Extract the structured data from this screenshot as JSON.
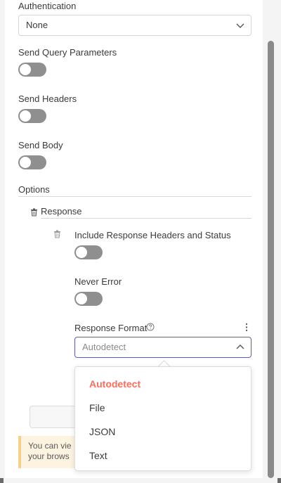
{
  "authentication": {
    "label": "Authentication",
    "value": "None"
  },
  "send_query": {
    "label": "Send Query Parameters",
    "enabled": false
  },
  "send_headers": {
    "label": "Send Headers",
    "enabled": false
  },
  "send_body": {
    "label": "Send Body",
    "enabled": false
  },
  "options": {
    "label": "Options",
    "response": {
      "label": "Response",
      "include_headers": {
        "label": "Include Response Headers and Status",
        "enabled": false
      },
      "never_error": {
        "label": "Never Error",
        "enabled": false
      },
      "response_format": {
        "label": "Response Format",
        "value": "Autodetect",
        "options": [
          "Autodetect",
          "File",
          "JSON",
          "Text"
        ]
      }
    }
  },
  "notice": {
    "line1": "You can vie",
    "line2": "your brows"
  },
  "icons": {
    "chevron": "chevron-down-icon",
    "chevron_up": "chevron-up-icon",
    "trash": "trash-icon",
    "help": "help-circle-icon",
    "more": "more-vertical-icon"
  },
  "colors": {
    "accent": "#ff6d5a",
    "focus_border": "#5d5fa8",
    "toggle_off": "#8f8f8f"
  }
}
